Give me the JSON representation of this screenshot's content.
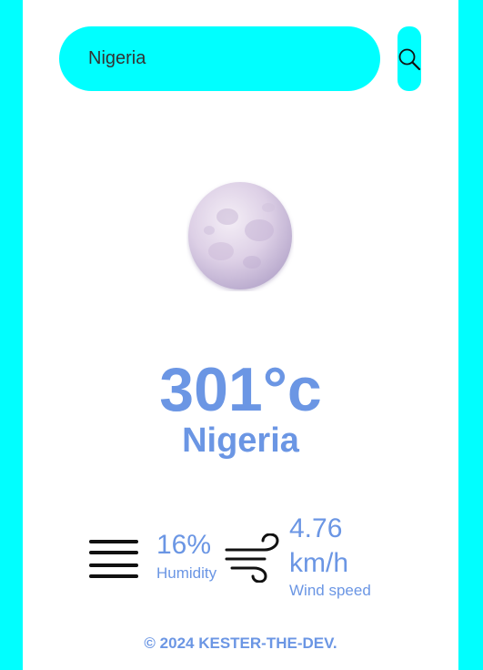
{
  "search": {
    "value": "Nigeria",
    "button_icon": "search-icon"
  },
  "weather": {
    "icon": "moon-icon",
    "temperature": "301°c",
    "city": "Nigeria"
  },
  "details": {
    "humidity": {
      "icon": "menu-lines-icon",
      "value": "16%",
      "label": "Humidity"
    },
    "wind": {
      "icon": "wind-icon",
      "value": "4.76 km/h",
      "label": "Wind speed"
    }
  },
  "footer": {
    "text": "© 2024 KESTER-THE-DEV."
  },
  "colors": {
    "background": "#00ffff",
    "card": "#ffffff",
    "accent": "#6b96e4"
  }
}
